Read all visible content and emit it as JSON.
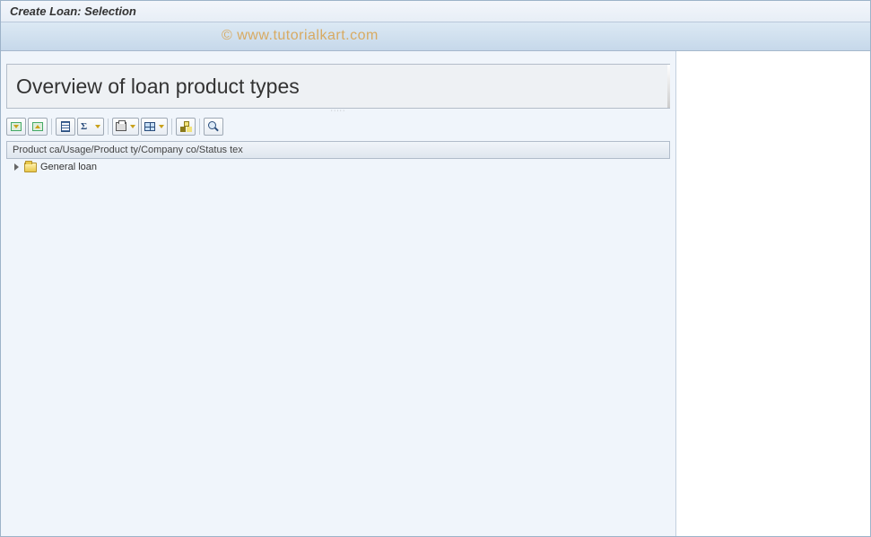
{
  "window": {
    "title": "Create Loan: Selection"
  },
  "watermark": "© www.tutorialkart.com",
  "heading": "Overview of loan product types",
  "toolbar": {
    "collapse_all": "Expand all",
    "expand_all": "Collapse all",
    "column_config": "Column configuration",
    "sum": "Sum",
    "print": "Print",
    "layout": "Change layout",
    "hierarchy": "Hierarchy",
    "find": "Find"
  },
  "columns": {
    "header": "Product ca/Usage/Product ty/Company co/Status tex"
  },
  "tree": {
    "items": [
      {
        "label": "General loan",
        "expanded": false
      }
    ]
  }
}
